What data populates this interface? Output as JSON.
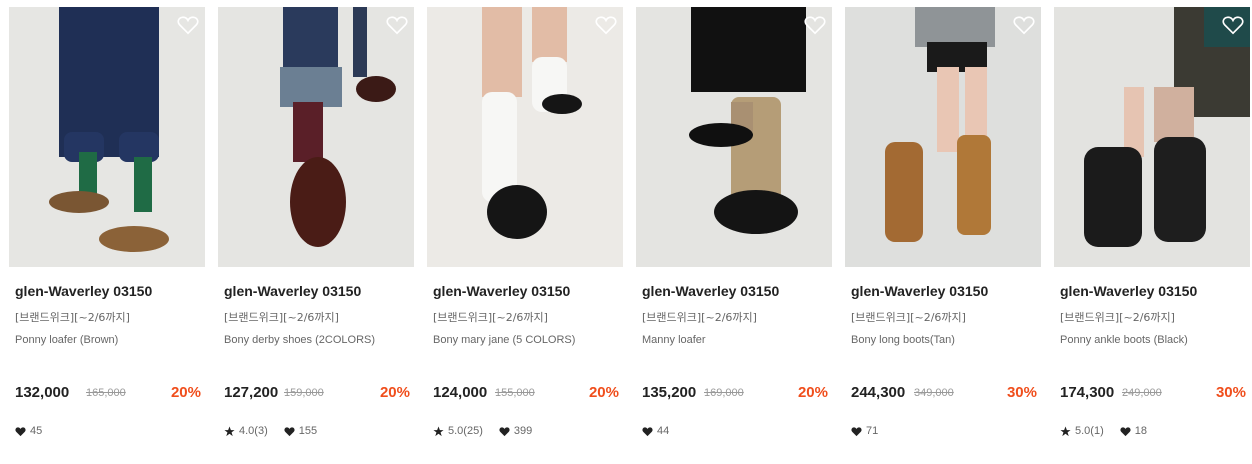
{
  "products": [
    {
      "brand": "glen-Waverley 03150",
      "promo": "[브랜드위크][~2/6까지]",
      "name": "Ponny loafer (Brown)",
      "price": "132,000",
      "original_price": "165,000",
      "discount": "20%",
      "rating": null,
      "likes": "45"
    },
    {
      "brand": "glen-Waverley 03150",
      "promo": "[브랜드위크][~2/6까지]",
      "name": "Bony derby shoes (2COLORS)",
      "price": "127,200",
      "original_price": "159,000",
      "discount": "20%",
      "rating": "4.0(3)",
      "likes": "155"
    },
    {
      "brand": "glen-Waverley 03150",
      "promo": "[브랜드위크][~2/6까지]",
      "name": "Bony mary jane (5 COLORS)",
      "price": "124,000",
      "original_price": "155,000",
      "discount": "20%",
      "rating": "5.0(25)",
      "likes": "399"
    },
    {
      "brand": "glen-Waverley 03150",
      "promo": "[브랜드위크][~2/6까지]",
      "name": "Manny loafer",
      "price": "135,200",
      "original_price": "169,000",
      "discount": "20%",
      "rating": null,
      "likes": "44"
    },
    {
      "brand": "glen-Waverley 03150",
      "promo": "[브랜드위크][~2/6까지]",
      "name": "Bony long boots(Tan)",
      "price": "244,300",
      "original_price": "349,000",
      "discount": "30%",
      "rating": null,
      "likes": "71"
    },
    {
      "brand": "glen-Waverley 03150",
      "promo": "[브랜드위크][~2/6까지]",
      "name": "Ponny ankle boots (Black)",
      "price": "174,300",
      "original_price": "249,000",
      "discount": "30%",
      "rating": "5.0(1)",
      "likes": "18"
    }
  ],
  "icons": {
    "wishlist": "heart-outline-icon",
    "rating": "star-icon",
    "likes": "heart-filled-icon"
  },
  "colors": {
    "discount": "#f04e1c",
    "text": "#222222",
    "muted": "#666666",
    "strike": "#999999"
  }
}
